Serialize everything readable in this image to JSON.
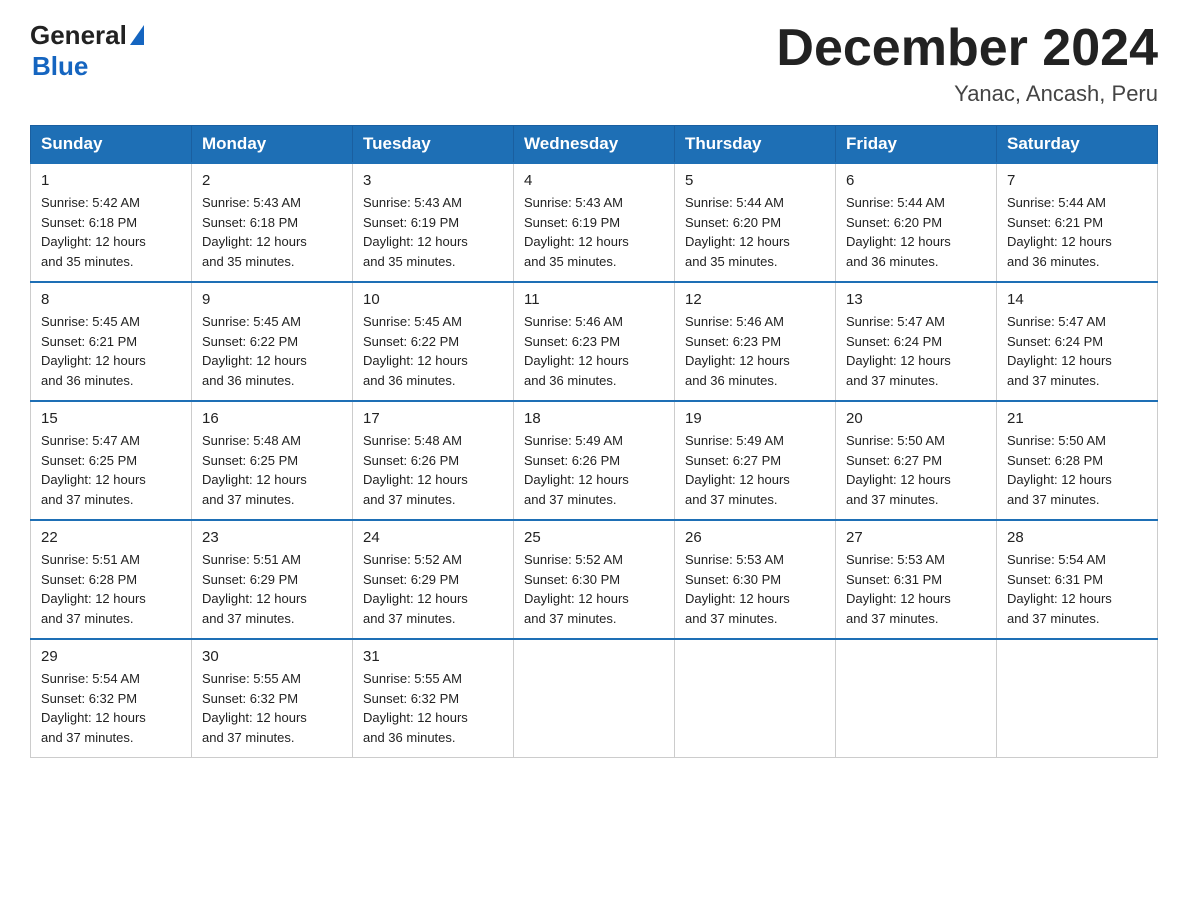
{
  "logo": {
    "general": "General",
    "blue": "Blue"
  },
  "title": "December 2024",
  "subtitle": "Yanac, Ancash, Peru",
  "days_of_week": [
    "Sunday",
    "Monday",
    "Tuesday",
    "Wednesday",
    "Thursday",
    "Friday",
    "Saturday"
  ],
  "weeks": [
    [
      {
        "day": "1",
        "sunrise": "5:42 AM",
        "sunset": "6:18 PM",
        "daylight": "12 hours and 35 minutes."
      },
      {
        "day": "2",
        "sunrise": "5:43 AM",
        "sunset": "6:18 PM",
        "daylight": "12 hours and 35 minutes."
      },
      {
        "day": "3",
        "sunrise": "5:43 AM",
        "sunset": "6:19 PM",
        "daylight": "12 hours and 35 minutes."
      },
      {
        "day": "4",
        "sunrise": "5:43 AM",
        "sunset": "6:19 PM",
        "daylight": "12 hours and 35 minutes."
      },
      {
        "day": "5",
        "sunrise": "5:44 AM",
        "sunset": "6:20 PM",
        "daylight": "12 hours and 35 minutes."
      },
      {
        "day": "6",
        "sunrise": "5:44 AM",
        "sunset": "6:20 PM",
        "daylight": "12 hours and 36 minutes."
      },
      {
        "day": "7",
        "sunrise": "5:44 AM",
        "sunset": "6:21 PM",
        "daylight": "12 hours and 36 minutes."
      }
    ],
    [
      {
        "day": "8",
        "sunrise": "5:45 AM",
        "sunset": "6:21 PM",
        "daylight": "12 hours and 36 minutes."
      },
      {
        "day": "9",
        "sunrise": "5:45 AM",
        "sunset": "6:22 PM",
        "daylight": "12 hours and 36 minutes."
      },
      {
        "day": "10",
        "sunrise": "5:45 AM",
        "sunset": "6:22 PM",
        "daylight": "12 hours and 36 minutes."
      },
      {
        "day": "11",
        "sunrise": "5:46 AM",
        "sunset": "6:23 PM",
        "daylight": "12 hours and 36 minutes."
      },
      {
        "day": "12",
        "sunrise": "5:46 AM",
        "sunset": "6:23 PM",
        "daylight": "12 hours and 36 minutes."
      },
      {
        "day": "13",
        "sunrise": "5:47 AM",
        "sunset": "6:24 PM",
        "daylight": "12 hours and 37 minutes."
      },
      {
        "day": "14",
        "sunrise": "5:47 AM",
        "sunset": "6:24 PM",
        "daylight": "12 hours and 37 minutes."
      }
    ],
    [
      {
        "day": "15",
        "sunrise": "5:47 AM",
        "sunset": "6:25 PM",
        "daylight": "12 hours and 37 minutes."
      },
      {
        "day": "16",
        "sunrise": "5:48 AM",
        "sunset": "6:25 PM",
        "daylight": "12 hours and 37 minutes."
      },
      {
        "day": "17",
        "sunrise": "5:48 AM",
        "sunset": "6:26 PM",
        "daylight": "12 hours and 37 minutes."
      },
      {
        "day": "18",
        "sunrise": "5:49 AM",
        "sunset": "6:26 PM",
        "daylight": "12 hours and 37 minutes."
      },
      {
        "day": "19",
        "sunrise": "5:49 AM",
        "sunset": "6:27 PM",
        "daylight": "12 hours and 37 minutes."
      },
      {
        "day": "20",
        "sunrise": "5:50 AM",
        "sunset": "6:27 PM",
        "daylight": "12 hours and 37 minutes."
      },
      {
        "day": "21",
        "sunrise": "5:50 AM",
        "sunset": "6:28 PM",
        "daylight": "12 hours and 37 minutes."
      }
    ],
    [
      {
        "day": "22",
        "sunrise": "5:51 AM",
        "sunset": "6:28 PM",
        "daylight": "12 hours and 37 minutes."
      },
      {
        "day": "23",
        "sunrise": "5:51 AM",
        "sunset": "6:29 PM",
        "daylight": "12 hours and 37 minutes."
      },
      {
        "day": "24",
        "sunrise": "5:52 AM",
        "sunset": "6:29 PM",
        "daylight": "12 hours and 37 minutes."
      },
      {
        "day": "25",
        "sunrise": "5:52 AM",
        "sunset": "6:30 PM",
        "daylight": "12 hours and 37 minutes."
      },
      {
        "day": "26",
        "sunrise": "5:53 AM",
        "sunset": "6:30 PM",
        "daylight": "12 hours and 37 minutes."
      },
      {
        "day": "27",
        "sunrise": "5:53 AM",
        "sunset": "6:31 PM",
        "daylight": "12 hours and 37 minutes."
      },
      {
        "day": "28",
        "sunrise": "5:54 AM",
        "sunset": "6:31 PM",
        "daylight": "12 hours and 37 minutes."
      }
    ],
    [
      {
        "day": "29",
        "sunrise": "5:54 AM",
        "sunset": "6:32 PM",
        "daylight": "12 hours and 37 minutes."
      },
      {
        "day": "30",
        "sunrise": "5:55 AM",
        "sunset": "6:32 PM",
        "daylight": "12 hours and 37 minutes."
      },
      {
        "day": "31",
        "sunrise": "5:55 AM",
        "sunset": "6:32 PM",
        "daylight": "12 hours and 36 minutes."
      },
      null,
      null,
      null,
      null
    ]
  ],
  "labels": {
    "sunrise": "Sunrise:",
    "sunset": "Sunset:",
    "daylight": "Daylight:"
  }
}
